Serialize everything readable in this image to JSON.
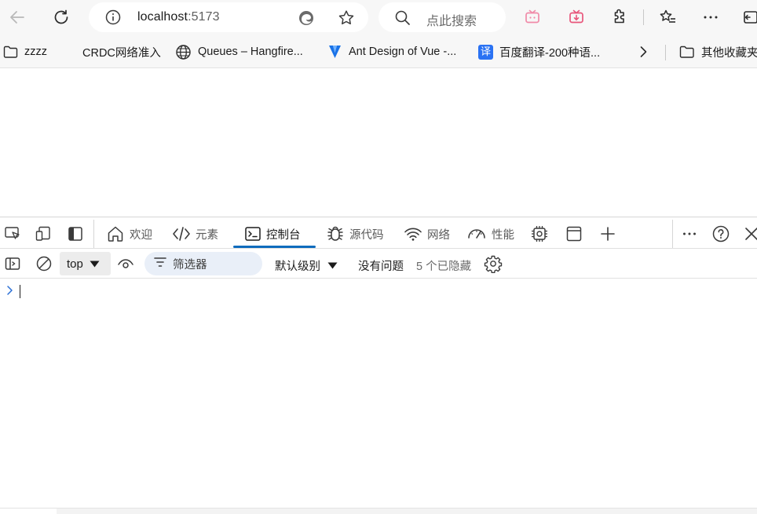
{
  "browser": {
    "address": {
      "host": "localhost",
      "port": ":5173"
    },
    "search_placeholder": "点此搜索"
  },
  "favorites": [
    {
      "label": "zzzz",
      "icon": "folder-icon"
    },
    {
      "label": "CRDC网络准入",
      "icon": "blank-page-icon"
    },
    {
      "label": "Queues – Hangfire...",
      "icon": "globe-icon"
    },
    {
      "label": "Ant Design of Vue -...",
      "icon": "antd-logo-icon"
    },
    {
      "label": "百度翻译-200种语...",
      "icon": "baidu-translate-icon",
      "icon_text": "译"
    },
    {
      "label": "其他收藏夹",
      "icon": "folder-icon"
    }
  ],
  "devtools": {
    "tabs": [
      {
        "label": "欢迎",
        "icon": "home-icon"
      },
      {
        "label": "元素",
        "icon": "code-icon"
      },
      {
        "label": "控制台",
        "icon": "console-icon",
        "active": true
      },
      {
        "label": "源代码",
        "icon": "bug-icon"
      },
      {
        "label": "网络",
        "icon": "wifi-icon"
      },
      {
        "label": "性能",
        "icon": "gauge-icon"
      }
    ],
    "console": {
      "context": "top",
      "filter_placeholder": "筛选器",
      "levels": "默认级别",
      "issues": "没有问题",
      "hidden": "5 个已隐藏"
    }
  },
  "colors": {
    "accent": "#0f6cbd",
    "prompt": "#2b6fd6"
  }
}
